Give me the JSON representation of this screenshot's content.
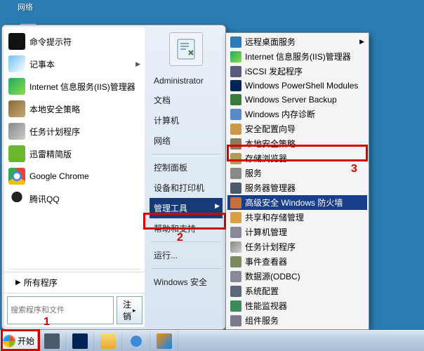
{
  "desktop": {
    "network_label": "网络"
  },
  "start_menu": {
    "programs": [
      {
        "label": "命令提示符",
        "icon": "c-cmd",
        "expandable": false
      },
      {
        "label": "记事本",
        "icon": "c-note",
        "expandable": true
      },
      {
        "label": "Internet 信息服务(IIS)管理器",
        "icon": "c-iis",
        "expandable": false
      },
      {
        "label": "本地安全策略",
        "icon": "c-sec",
        "expandable": false
      },
      {
        "label": "任务计划程序",
        "icon": "c-task",
        "expandable": false
      },
      {
        "label": "迅雷精简版",
        "icon": "c-xl",
        "expandable": false
      },
      {
        "label": "Google Chrome",
        "icon": "c-chrome",
        "expandable": false
      },
      {
        "label": "腾讯QQ",
        "icon": "c-qq",
        "expandable": false
      }
    ],
    "all_programs": "所有程序",
    "search_placeholder": "搜索程序和文件",
    "logout_button": "注销",
    "right": {
      "username": "Administrator",
      "links": [
        "文档",
        "计算机",
        "网络",
        "控制面板",
        "设备和打印机",
        "管理工具",
        "帮助和支持",
        "运行...",
        "Windows 安全"
      ],
      "selected_index": 5
    }
  },
  "submenu": {
    "items": [
      {
        "label": "远程桌面服务",
        "icon": "c-rdp",
        "expandable": true
      },
      {
        "label": "Internet 信息服务(IIS)管理器",
        "icon": "c-iis"
      },
      {
        "label": "iSCSI 发起程序",
        "icon": "c-isci"
      },
      {
        "label": "Windows PowerShell Modules",
        "icon": "c-ps"
      },
      {
        "label": "Windows Server Backup",
        "icon": "c-bak"
      },
      {
        "label": "Windows 内存诊断",
        "icon": "c-mem"
      },
      {
        "label": "安全配置向导",
        "icon": "c-wiz"
      },
      {
        "label": "本地安全策略",
        "icon": "c-pol"
      },
      {
        "label": "存储浏览器",
        "icon": "c-store"
      },
      {
        "label": "服务",
        "icon": "c-svc"
      },
      {
        "label": "服务器管理器",
        "icon": "c-srv"
      },
      {
        "label": "高级安全 Windows 防火墙",
        "icon": "c-fw",
        "selected": true
      },
      {
        "label": "共享和存储管理",
        "icon": "c-share"
      },
      {
        "label": "计算机管理",
        "icon": "c-comp"
      },
      {
        "label": "任务计划程序",
        "icon": "c-task"
      },
      {
        "label": "事件查看器",
        "icon": "c-evt"
      },
      {
        "label": "数据源(ODBC)",
        "icon": "c-odbc"
      },
      {
        "label": "系统配置",
        "icon": "c-sys"
      },
      {
        "label": "性能监视器",
        "icon": "c-perf"
      },
      {
        "label": "组件服务",
        "icon": "c-dcom"
      }
    ]
  },
  "taskbar": {
    "start_label": "开始"
  },
  "annotations": {
    "n1": "1",
    "n2": "2",
    "n3": "3"
  }
}
